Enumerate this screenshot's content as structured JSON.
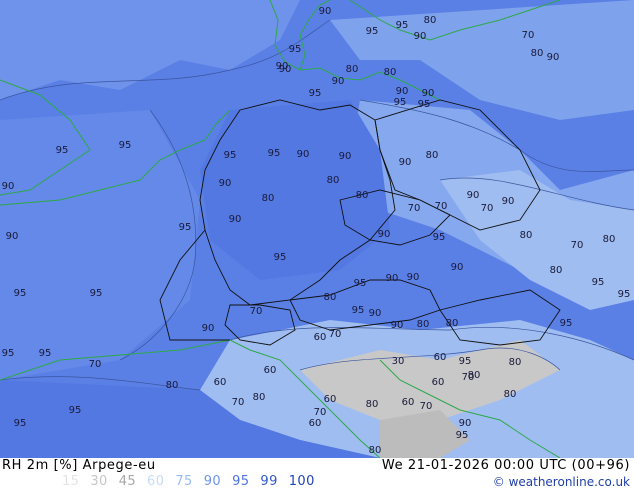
{
  "map": {
    "title": "RH 2m [%] Arpege-eu",
    "valid_time": "We 21-01-2026 00:00 UTC (00+96)",
    "credit": "© weatheronline.co.uk",
    "colors": {
      "level_90_95": "#5a80e6",
      "level_95_99": "#4a6fd8",
      "level_80_90": "#7ea2ec",
      "level_70_80": "#9fbdf0",
      "level_60_70": "#b9d0f2",
      "level_low": "#c8c8c8",
      "coast": "#2ea84a",
      "border": "#111111",
      "isoline": "#3a55a0"
    },
    "scale": [
      {
        "label": "15",
        "color": "#e4e4e4"
      },
      {
        "label": "30",
        "color": "#c6c6c6"
      },
      {
        "label": "45",
        "color": "#a8a8a8"
      },
      {
        "label": "60",
        "color": "#c7dbf6"
      },
      {
        "label": "75",
        "color": "#9bbcf2"
      },
      {
        "label": "90",
        "color": "#6e95ea"
      },
      {
        "label": "95",
        "color": "#4c74df"
      },
      {
        "label": "99",
        "color": "#2f58d2"
      },
      {
        "label": "100",
        "color": "#1f43c0"
      }
    ],
    "contour_labels": [
      "90",
      "95",
      "80",
      "90",
      "95",
      "70",
      "80",
      "90",
      "90",
      "95",
      "90",
      "80",
      "90",
      "80",
      "90",
      "95",
      "95",
      "90",
      "95",
      "95",
      "95",
      "90",
      "90",
      "95",
      "95",
      "80",
      "90",
      "90",
      "90",
      "80",
      "80",
      "90",
      "70",
      "80",
      "90",
      "70",
      "90",
      "70",
      "80",
      "70",
      "95",
      "90",
      "90",
      "95",
      "95",
      "80",
      "90",
      "80",
      "95",
      "95",
      "90",
      "95",
      "90",
      "70",
      "80",
      "95",
      "90",
      "95",
      "90",
      "95",
      "95",
      "70",
      "60",
      "80",
      "90",
      "80",
      "95",
      "80",
      "60",
      "60",
      "60",
      "70",
      "30",
      "60",
      "80",
      "60",
      "70",
      "60",
      "80",
      "80",
      "70",
      "70",
      "80",
      "60",
      "80",
      "70",
      "95",
      "95",
      "95",
      "90",
      "95",
      "95",
      "80"
    ]
  }
}
